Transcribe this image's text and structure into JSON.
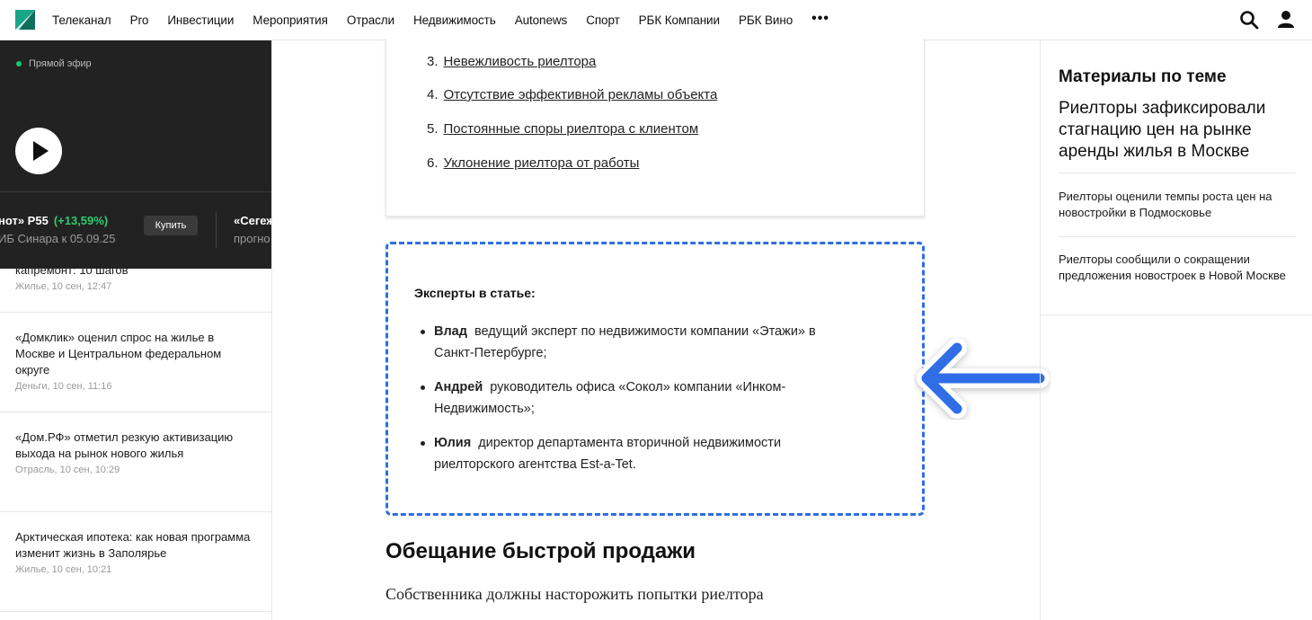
{
  "nav": {
    "items": [
      "Телеканал",
      "Pro",
      "Инвестиции",
      "Мероприятия",
      "Отрасли",
      "Недвижимость",
      "Autonews",
      "Спорт",
      "РБК Компании",
      "РБК Вино"
    ],
    "more": "•••"
  },
  "video": {
    "live_label": "Прямой эфир"
  },
  "ticker": {
    "name": "нот» Р55",
    "change": "(+13,59%)",
    "sub": "ИБ Синара к 05.09.25",
    "buy_label": "Купить",
    "second_name": "«Сегеж",
    "second_sub": "прогно"
  },
  "news": [
    {
      "title": "капремонт: 10 шагов",
      "meta": "Жилье, 10 сен, 12:47"
    },
    {
      "title": "«Домклик» оценил спрос на жилье в Москве и Центральном федеральном округе",
      "meta": "Деньги, 10 сен, 11:16"
    },
    {
      "title": "«Дом.РФ» отметил резкую активизацию выхода на рынок нового жилья",
      "meta": "Отрасль, 10 сен, 10:29"
    },
    {
      "title": "Арктическая ипотека: как новая программа изменит жизнь в Заполярье",
      "meta": "Жилье, 10 сен, 10:21"
    }
  ],
  "toc": [
    {
      "num": "3.",
      "text": "Невежливость риелтора"
    },
    {
      "num": "4.",
      "text": "Отсутствие эффективной рекламы объекта"
    },
    {
      "num": "5.",
      "text": "Постоянные споры риелтора с клиентом"
    },
    {
      "num": "6.",
      "text": "Уклонение риелтора от работы"
    }
  ],
  "experts": {
    "title": "Эксперты в статье:",
    "items": [
      {
        "name": "Влад",
        "desc": "ведущий эксперт по недвижимости компании «Этажи» в Санкт-Петербурге;"
      },
      {
        "name": "Андрей",
        "desc": "руководитель офиса «Сокол» компании «Инком-Недвижимость»;"
      },
      {
        "name": "Юлия",
        "desc": "директор департамента вторичной недвижимости риелторского агентства Est-a-Tet."
      }
    ]
  },
  "article": {
    "heading": "Обещание быстрой продажи",
    "paragraph_start": "Собственника должны насторожить попытки риелтора"
  },
  "related": {
    "heading": "Материалы по теме",
    "main": "Риелторы зафиксировали стагнацию цен на рынке аренды жилья в Москве",
    "items": [
      "Риелторы оценили темпы роста цен на новостройки в Подмосковье",
      "Риелторы сообщили о сокращении предложения новостроек в Новой Москве"
    ]
  },
  "colors": {
    "accent_blue": "#2f6fe0",
    "arrow_blue": "#2f6ee6",
    "logo_green": "#1aa589",
    "live_green": "#19c37a",
    "gain_green": "#2ecc71"
  }
}
